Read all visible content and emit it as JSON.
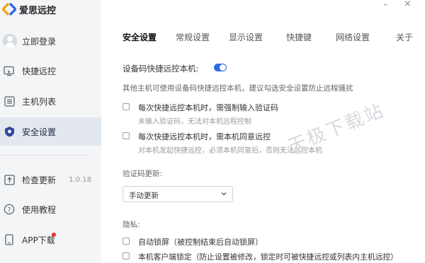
{
  "app": {
    "title": "爱思远控"
  },
  "window": {
    "minimize_glyph": "–",
    "close_glyph": "×"
  },
  "sidebar": {
    "login": {
      "label": "立即登录",
      "icon": "avatar-icon"
    },
    "items": [
      {
        "label": "快捷远控",
        "icon": "remote-monitor-icon"
      },
      {
        "label": "主机列表",
        "icon": "list-icon"
      },
      {
        "label": "安全设置",
        "icon": "shield-icon",
        "active": true
      }
    ],
    "bottom": [
      {
        "label": "检查更新",
        "icon": "upload-icon",
        "version": "1.0.18"
      },
      {
        "label": "使用教程",
        "icon": "help-icon"
      },
      {
        "label": "APP下载",
        "icon": "phone-icon",
        "badge": true
      }
    ]
  },
  "tabs": [
    {
      "label": "安全设置",
      "active": true
    },
    {
      "label": "常规设置"
    },
    {
      "label": "显示设置"
    },
    {
      "label": "快捷键"
    },
    {
      "label": "网络设置"
    },
    {
      "label": "关于"
    }
  ],
  "security": {
    "device_code_label": "设备码快捷远控本机:",
    "device_code_enabled": true,
    "recommend_note": "其他主机可使用设备码快捷远控本机，建议勾选安全设置防止远程骚扰",
    "opt1": {
      "label": "每次快捷远控本机时，需强制输入验证码",
      "hint": "未输入验证码，无法对本机远程控制",
      "checked": false
    },
    "opt2": {
      "label": "每次快捷远控本机时，需本机同意远控",
      "hint": "对本机发起快捷远控，必须本机同意后，否则无法远控本机",
      "checked": false
    },
    "code_update_label": "验证码更新:",
    "code_update_value": "手动更新",
    "privacy_label": "隐私:",
    "privacy1": {
      "label": "自动锁屏（被控制结束后自动锁屏）",
      "checked": false
    },
    "privacy2": {
      "label": "本机客户端锁定（防止设置被修改，锁定时可被快捷远控或列表内主机远控）",
      "checked": false
    }
  },
  "watermark": "天极下载站",
  "colors": {
    "accent": "#2e6be6",
    "sidebar_bg": "#f4f5f7",
    "active_item_bg": "#e3e7ee",
    "badge": "#f02f2f"
  }
}
